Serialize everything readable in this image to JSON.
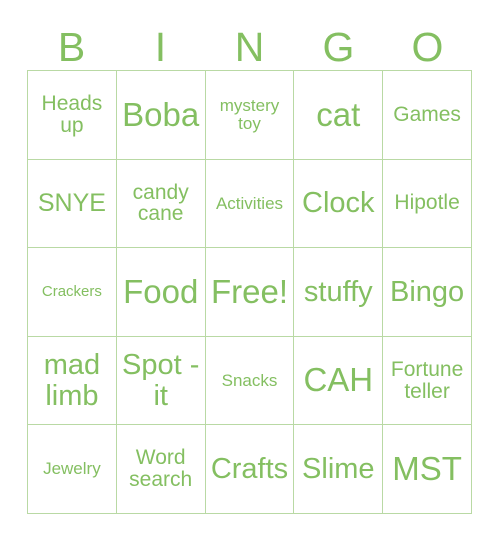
{
  "card": {
    "title": "BINGO",
    "header_letters": [
      "B",
      "I",
      "N",
      "G",
      "O"
    ],
    "colors": {
      "text": "#84bf61",
      "border": "#b9d9a4",
      "background": "#ffffff"
    },
    "grid_size": "5x5",
    "free_space": "Free!",
    "cells": [
      {
        "text": "Heads up",
        "size": "md"
      },
      {
        "text": "Boba",
        "size": "xxl"
      },
      {
        "text": "mystery toy",
        "size": "sm"
      },
      {
        "text": "cat",
        "size": "xxl"
      },
      {
        "text": "Games",
        "size": "md"
      },
      {
        "text": "SNYE",
        "size": "lg"
      },
      {
        "text": "candy cane",
        "size": "md"
      },
      {
        "text": "Activities",
        "size": "sm"
      },
      {
        "text": "Clock",
        "size": "xl"
      },
      {
        "text": "Hipotle",
        "size": "md"
      },
      {
        "text": "Crackers",
        "size": "xs"
      },
      {
        "text": "Food",
        "size": "xxl"
      },
      {
        "text": "Free!",
        "size": "xxl"
      },
      {
        "text": "stuffy",
        "size": "xl"
      },
      {
        "text": "Bingo",
        "size": "xl"
      },
      {
        "text": "mad limb",
        "size": "xl"
      },
      {
        "text": "Spot -it",
        "size": "xl"
      },
      {
        "text": "Snacks",
        "size": "sm"
      },
      {
        "text": "CAH",
        "size": "xxl"
      },
      {
        "text": "Fortune teller",
        "size": "md"
      },
      {
        "text": "Jewelry",
        "size": "sm"
      },
      {
        "text": "Word search",
        "size": "md"
      },
      {
        "text": "Crafts",
        "size": "xl"
      },
      {
        "text": "Slime",
        "size": "xl"
      },
      {
        "text": "MST",
        "size": "xxl"
      }
    ]
  }
}
